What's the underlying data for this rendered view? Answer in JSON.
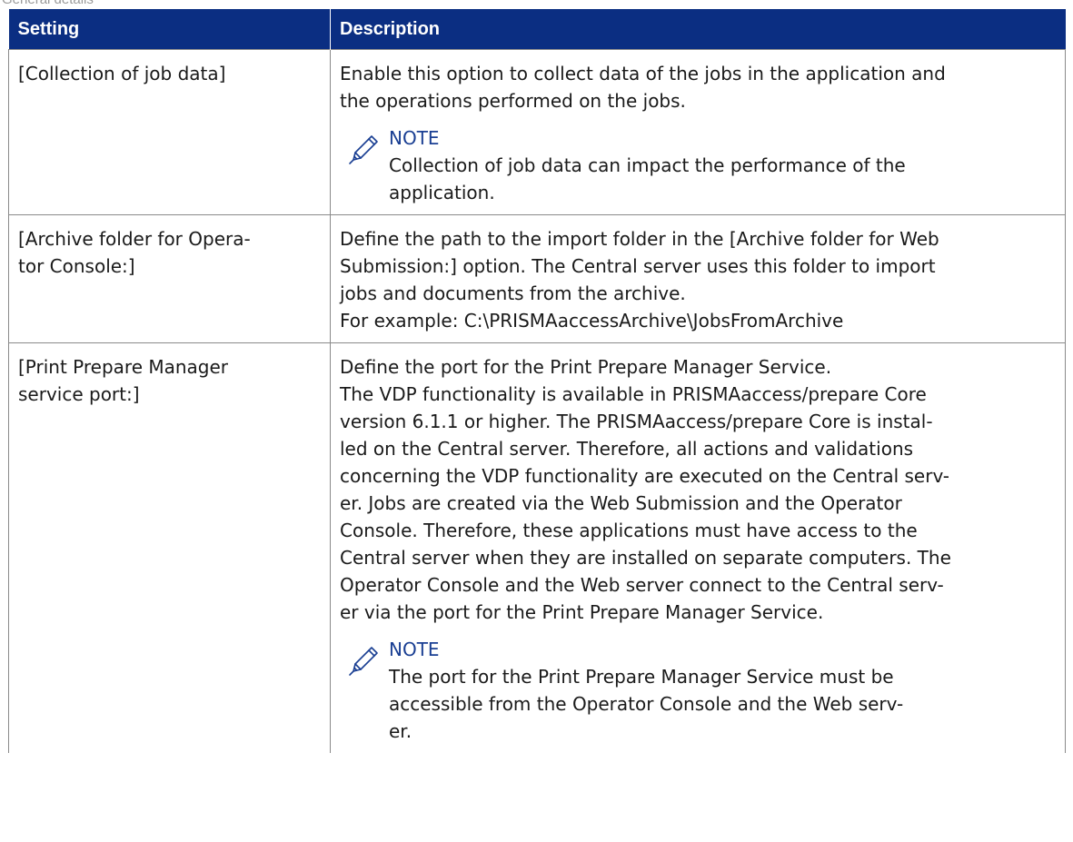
{
  "caption": "General details",
  "table": {
    "headers": [
      "Setting",
      "Description"
    ],
    "rows": [
      {
        "setting": "[Collection of job data]",
        "description": [
          "Enable this option to collect data of the jobs in the application and",
          "the operations performed on the jobs."
        ],
        "note": {
          "title": "NOTE",
          "text": [
            "Collection of job data can impact the performance of the",
            "application."
          ]
        }
      },
      {
        "setting": [
          "[Archive folder for Opera-",
          "tor Console:]"
        ],
        "description": [
          "Define the path to the import folder in the [Archive folder for Web",
          "Submission:] option. The Central server uses this folder to import",
          "jobs and documents from the archive.",
          "For example: C:\\PRISMAaccessArchive\\JobsFromArchive"
        ]
      },
      {
        "setting": [
          "[Print Prepare Manager",
          "service port:]"
        ],
        "description": [
          "Define the port for the Print Prepare Manager Service.",
          "The VDP functionality is available in PRISMAaccess/prepare Core",
          "version 6.1.1 or higher. The PRISMAaccess/prepare Core is instal-",
          "led on the Central server. Therefore, all actions and validations",
          "concerning the VDP functionality are executed on the Central serv-",
          "er. Jobs are created via the Web Submission and the Operator",
          "Console. Therefore, these applications must have access to the",
          "Central server when they are installed on separate computers. The",
          "Operator Console and the Web server connect to the Central serv-",
          "er via the port for the Print Prepare Manager Service."
        ],
        "note": {
          "title": "NOTE",
          "text": [
            "The port for the Print Prepare Manager Service must be",
            "accessible from the Operator Console and the Web serv-",
            "er."
          ]
        }
      }
    ]
  },
  "icons": {
    "note": "pencil-note-icon"
  },
  "colors": {
    "header_bg": "#0b2e82",
    "header_text": "#ffffff",
    "note_title": "#1a3f93",
    "border": "#8a8a8a"
  }
}
